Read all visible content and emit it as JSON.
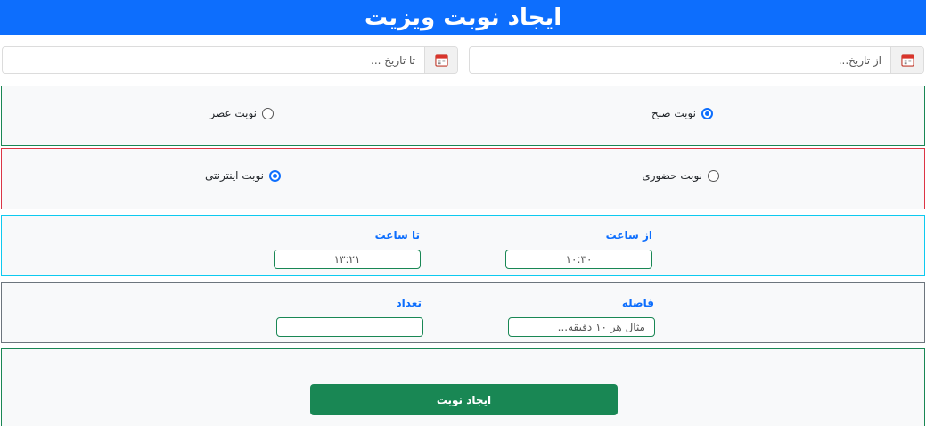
{
  "header": {
    "title": "ایجاد نوبت ویزیت"
  },
  "date_range": {
    "from_placeholder": "از تاریخ...",
    "to_placeholder": "تا تاریخ ...",
    "icon": "calendar-icon"
  },
  "shift": {
    "options": [
      {
        "label": "نوبت صبح",
        "checked": true
      },
      {
        "label": "نوبت عصر",
        "checked": false
      }
    ]
  },
  "visit_type": {
    "options": [
      {
        "label": "نوبت حضوری",
        "checked": false
      },
      {
        "label": "نوبت اینترنتی",
        "checked": true
      }
    ]
  },
  "time": {
    "from_label": "از ساعت",
    "from_value": "۱۰:۳۰",
    "to_label": "تا ساعت",
    "to_value": "۱۳:۲۱"
  },
  "interval": {
    "gap_label": "فاصله",
    "gap_placeholder": "مثال هر ۱۰ دقیقه...",
    "count_label": "تعداد",
    "count_value": ""
  },
  "actions": {
    "submit_label": "ایجاد نوبت"
  },
  "colors": {
    "primary": "#0d6efd",
    "success": "#198754",
    "danger": "#dc3545",
    "info": "#0dcaf0",
    "secondary": "#6c757d"
  }
}
